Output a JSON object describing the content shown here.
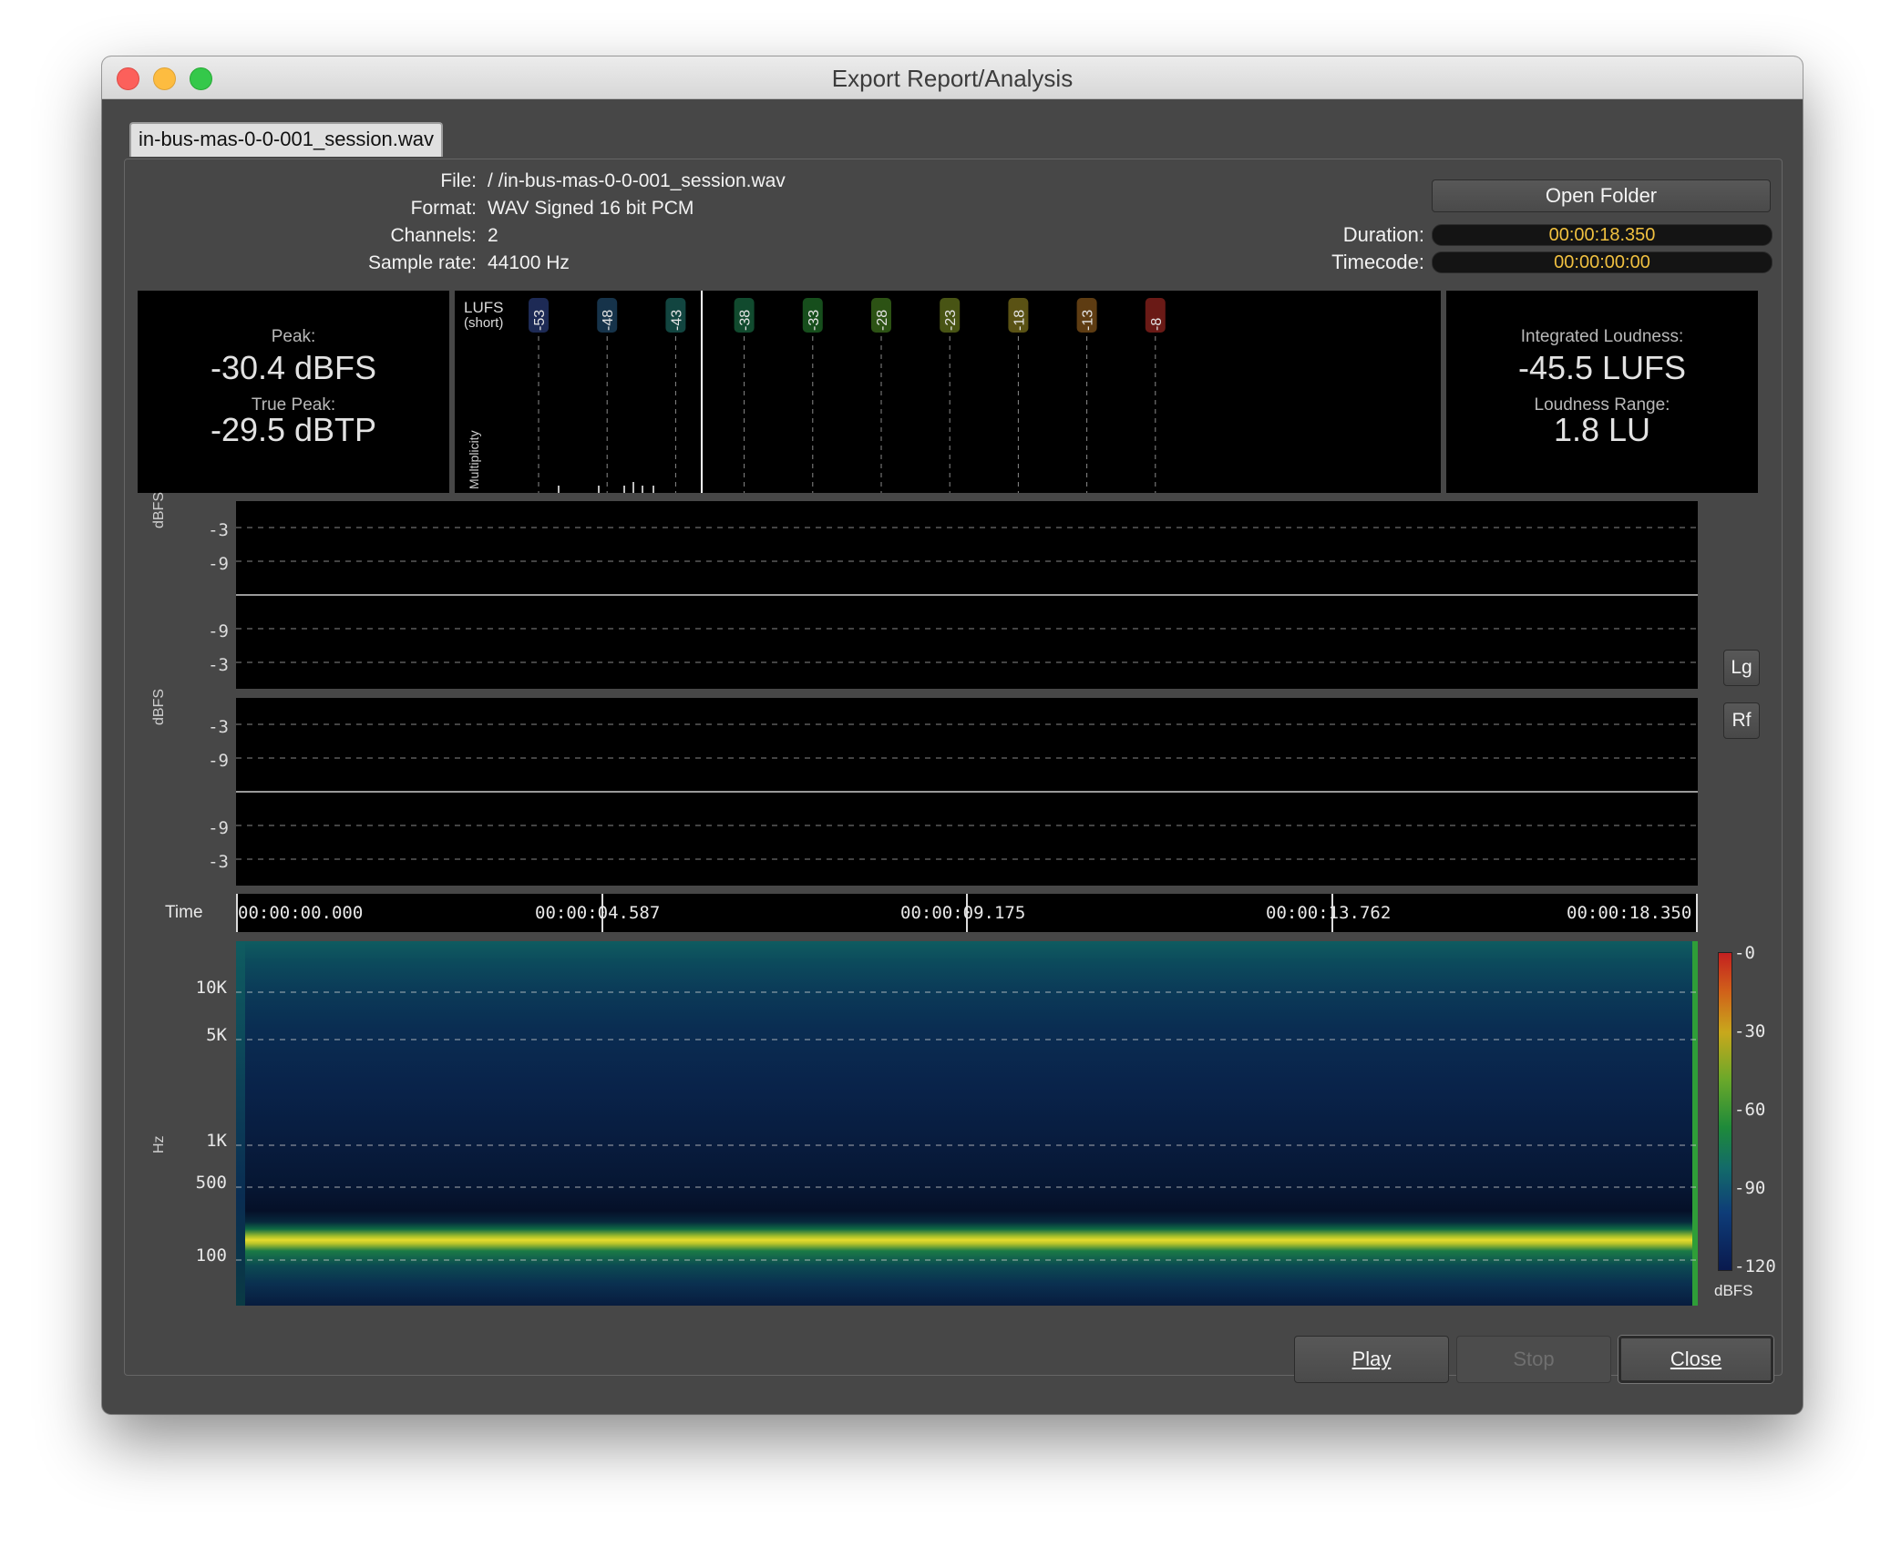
{
  "window": {
    "title": "Export Report/Analysis"
  },
  "tab": {
    "label": "in-bus-mas-0-0-001_session.wav"
  },
  "info": {
    "file_label": "File:",
    "file_value": "/                              /in-bus-mas-0-0-001_session.wav",
    "format_label": "Format:",
    "format_value": "WAV Signed 16 bit PCM",
    "channels_label": "Channels:",
    "channels_value": "2",
    "samplerate_label": "Sample rate:",
    "samplerate_value": "44100 Hz"
  },
  "open_folder_label": "Open Folder",
  "duration": {
    "label": "Duration:",
    "value": "00:00:18.350"
  },
  "timecode": {
    "label": "Timecode:",
    "value": "00:00:00:00"
  },
  "peak": {
    "label": "Peak:",
    "value": "-30.4 dBFS",
    "true_label": "True Peak:",
    "true_value": "-29.5 dBTP"
  },
  "loudness": {
    "integrated_label": "Integrated Loudness:",
    "integrated_value": "-45.5 LUFS",
    "range_label": "Loudness Range:",
    "range_value": "1.8 LU"
  },
  "histogram": {
    "unit_line1": "LUFS",
    "unit_line2": "(short)",
    "multiplicity_label": "Multiplicity",
    "markers": [
      {
        "label": "-53",
        "color": "#1d2a55"
      },
      {
        "label": "-48",
        "color": "#16334a"
      },
      {
        "label": "-43",
        "color": "#124540"
      },
      {
        "label": "-38",
        "color": "#114a2e"
      },
      {
        "label": "-33",
        "color": "#164e1c"
      },
      {
        "label": "-28",
        "color": "#2c5214"
      },
      {
        "label": "-23",
        "color": "#485414"
      },
      {
        "label": "-18",
        "color": "#5a5214"
      },
      {
        "label": "-13",
        "color": "#5e3c12"
      },
      {
        "label": "-8",
        "color": "#6a1a16"
      }
    ]
  },
  "waveform": {
    "unit": "dBFS",
    "ticks_upper": [
      "-3",
      "-9"
    ],
    "ticks_lower": [
      "-9",
      "-3"
    ]
  },
  "buttons": {
    "lg": "Lg",
    "rf": "Rf",
    "play": "Play",
    "stop": "Stop",
    "close": "Close"
  },
  "timeline": {
    "label": "Time",
    "ticks": [
      "00:00:00.000",
      "00:00:04.587",
      "00:00:09.175",
      "00:00:13.762",
      "00:00:18.350"
    ]
  },
  "spectrogram": {
    "unit": "Hz",
    "freqs": [
      "10K",
      "5K",
      "1K",
      "500",
      "100"
    ]
  },
  "colorscale": {
    "ticks": [
      "-0",
      "-30",
      "-60",
      "-90",
      "-120"
    ],
    "unit": "dBFS"
  }
}
